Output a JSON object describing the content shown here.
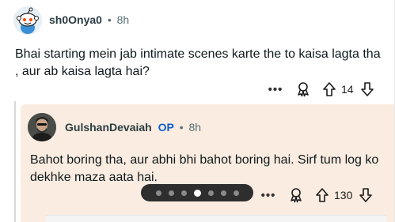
{
  "comment": {
    "username": "sh0Onya0",
    "separator": "•",
    "age": "8h",
    "body": "Bhai starting mein jab intimate scenes karte the to kaisa lagta tha , aur ab kaisa lagta hai?",
    "more_label": "•••",
    "vote_count": "14"
  },
  "reply": {
    "username": "GulshanDevaiah",
    "op_badge": "OP",
    "separator": "•",
    "age": "8h",
    "body": "Bahot boring tha, aur abhi bhi bahot boring hai. Sirf tum log ko dekhke maza aata hai.",
    "more_label": "•••",
    "vote_count": "130"
  },
  "pager": {
    "dot_count": 7,
    "active_index": 3
  },
  "icons": {
    "award": "award-icon",
    "upvote": "upvote-arrow-icon",
    "downvote": "downvote-arrow-icon",
    "more": "more-options-icon"
  },
  "colors": {
    "op_badge": "#0a5ec9",
    "reply_background": "#fbece1",
    "meta_text": "#576f76"
  }
}
